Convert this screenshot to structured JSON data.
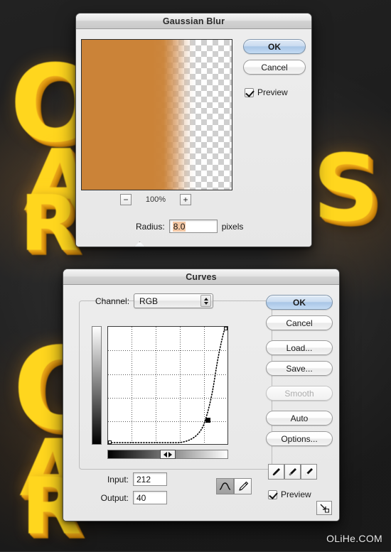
{
  "background": {
    "glyphs": [
      {
        "char": "O",
        "cls": "g-o"
      },
      {
        "char": "A",
        "cls": "g-a"
      },
      {
        "char": "R",
        "cls": "g-r1"
      },
      {
        "char": "S",
        "cls": "g-s"
      },
      {
        "char": "O",
        "cls": "g-o2"
      },
      {
        "char": "A",
        "cls": "g-a2"
      },
      {
        "char": "R",
        "cls": "g-r2"
      }
    ],
    "watermark": "OLiHe.COM",
    "colors": {
      "backdrop": "#2e2e2e",
      "glyph_face": "#FFD61E",
      "glyph_extrude": "#E8A317"
    }
  },
  "gaussian_blur": {
    "title": "Gaussian Blur",
    "preview": {
      "zoom_out_label": "−",
      "zoom_level": "100%",
      "zoom_in_label": "+",
      "orange_color": "#cb8338"
    },
    "radius": {
      "label": "Radius:",
      "value": "8.0",
      "units": "pixels",
      "slider_percent": 23
    },
    "buttons": {
      "ok": "OK",
      "cancel": "Cancel"
    },
    "preview_checkbox": {
      "label": "Preview",
      "checked": true
    }
  },
  "curves": {
    "title": "Curves",
    "channel": {
      "label": "Channel:",
      "value": "RGB"
    },
    "buttons": {
      "ok": "OK",
      "cancel": "Cancel",
      "load": "Load...",
      "save": "Save...",
      "smooth": "Smooth",
      "auto": "Auto",
      "options": "Options..."
    },
    "smooth_disabled": true,
    "input": {
      "label": "Input:",
      "value": "212"
    },
    "output": {
      "label": "Output:",
      "value": "40"
    },
    "preview_checkbox": {
      "label": "Preview",
      "checked": true
    },
    "tools": {
      "curve_tool": "curve-tool-icon",
      "pencil_tool": "pencil-tool-icon",
      "curve_tool_selected": true,
      "eyedroppers": [
        "black-point-eyedropper",
        "gray-point-eyedropper",
        "white-point-eyedropper"
      ],
      "resize": "resize-grip-icon"
    },
    "graph": {
      "grid_divisions": 4,
      "gradient_vertical": "white-to-black",
      "gradient_horizontal": "black-to-white",
      "control_point": {
        "input": 212,
        "output": 40
      }
    }
  },
  "chart_data": {
    "type": "line",
    "title": "Curves tone curve (RGB)",
    "xlabel": "Input",
    "ylabel": "Output",
    "xlim": [
      0,
      255
    ],
    "ylim": [
      0,
      255
    ],
    "grid": true,
    "legend": "none",
    "annotations": [
      "Input: 212",
      "Output: 40"
    ],
    "points": [
      {
        "x": 0,
        "y": 0
      },
      {
        "x": 150,
        "y": 0
      },
      {
        "x": 180,
        "y": 3
      },
      {
        "x": 198,
        "y": 14
      },
      {
        "x": 212,
        "y": 40
      },
      {
        "x": 222,
        "y": 78
      },
      {
        "x": 232,
        "y": 126
      },
      {
        "x": 240,
        "y": 172
      },
      {
        "x": 248,
        "y": 216
      },
      {
        "x": 255,
        "y": 255
      }
    ],
    "control_points": [
      {
        "x": 0,
        "y": 0
      },
      {
        "x": 212,
        "y": 40
      },
      {
        "x": 255,
        "y": 255
      }
    ]
  }
}
